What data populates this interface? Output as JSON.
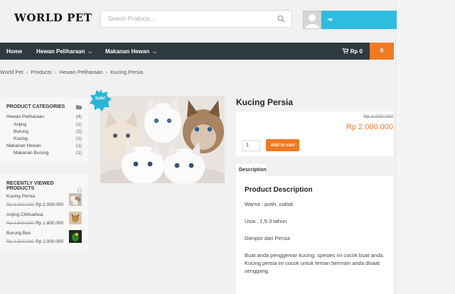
{
  "header": {
    "logo": "WORLD PET",
    "search_placeholder": "Search Products..."
  },
  "nav": {
    "items": [
      {
        "label": "Home"
      },
      {
        "label": "Hewan Peliharaan"
      },
      {
        "label": "Makanan Hewan"
      }
    ],
    "cart_label": "Rp 0",
    "cart_count": "0"
  },
  "breadcrumb": [
    "World Pet",
    "Products",
    "Hewan Peliharaan",
    "Kucing Persia"
  ],
  "categories": {
    "title": "PRODUCT CATEGORIES",
    "items": [
      {
        "label": "Hewan Peliharaan",
        "count": "(4)"
      },
      {
        "label": "Anjing",
        "count": "(1)"
      },
      {
        "label": "Burung",
        "count": "(2)"
      },
      {
        "label": "Kucing",
        "count": "(1)"
      },
      {
        "label": "Makanan Hewan",
        "count": "(1)"
      },
      {
        "label": "Makanan Burung",
        "count": "(1)"
      }
    ]
  },
  "recent": {
    "title": "RECENTLY VIEWED PRODUCTS",
    "items": [
      {
        "name": "Kucing Persia",
        "old_price": "Rp 3.000.000",
        "price": "Rp 2.000.000"
      },
      {
        "name": "Anjing Chihuahua",
        "old_price": "Rp 2.800.000",
        "price": "Rp 1.800.000"
      },
      {
        "name": "Burung Beo",
        "old_price": "Rp 2.500.000",
        "price": "Rp 2.000.000"
      }
    ]
  },
  "product": {
    "sale_badge": "Sale!",
    "title": "Kucing Persia",
    "old_price": "Rp 3.000.000",
    "price": "Rp 2.000.000",
    "quantity": "1",
    "add_to_cart": "Add to cart"
  },
  "description": {
    "tab": "Description",
    "title": "Product Description",
    "lines": [
      "Warna : putih, coklat",
      "Usia : 1,5-3 tahun",
      "Diimpor dari Persia",
      "Buat anda penggemar kucing, spesies ini cocok buat anda. Kucing persia ini cocok untuk teman bermain anda disaat senggang."
    ]
  },
  "colors": {
    "accent": "#f07a22",
    "nav": "#2d3a3e",
    "account": "#2ebce0",
    "sale_badge": "#29b6d6"
  }
}
